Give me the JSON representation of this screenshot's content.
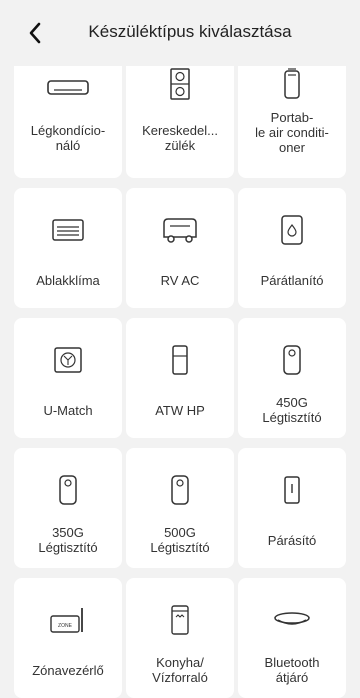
{
  "header": {
    "title": "Készüléktípus kiválasztása"
  },
  "devices": [
    {
      "label": "Légkondício-\nnáló",
      "icon": "air-conditioner-icon"
    },
    {
      "label": "Kereskedel...\nzülék",
      "icon": "commercial-unit-icon"
    },
    {
      "label": "Portab-\nle air conditi-\noner",
      "icon": "portable-ac-icon"
    },
    {
      "label": "Ablakklíma",
      "icon": "window-ac-icon"
    },
    {
      "label": "RV AC",
      "icon": "rv-ac-icon"
    },
    {
      "label": "Párátlanító",
      "icon": "dehumidifier-icon"
    },
    {
      "label": "U-Match",
      "icon": "u-match-icon"
    },
    {
      "label": "ATW HP",
      "icon": "heat-pump-icon"
    },
    {
      "label": "450G\nLégtisztító",
      "icon": "air-purifier-icon"
    },
    {
      "label": "350G\nLégtisztító",
      "icon": "air-purifier-icon"
    },
    {
      "label": "500G\nLégtisztító",
      "icon": "air-purifier-icon"
    },
    {
      "label": "Párásító",
      "icon": "humidifier-icon"
    },
    {
      "label": "Zónavezérlő",
      "icon": "zone-controller-icon",
      "icon_text": "ZONE"
    },
    {
      "label": "Konyha/\nVízforraló",
      "icon": "kettle-icon"
    },
    {
      "label": "Bluetooth\nátjáró",
      "icon": "bluetooth-gateway-icon"
    }
  ]
}
